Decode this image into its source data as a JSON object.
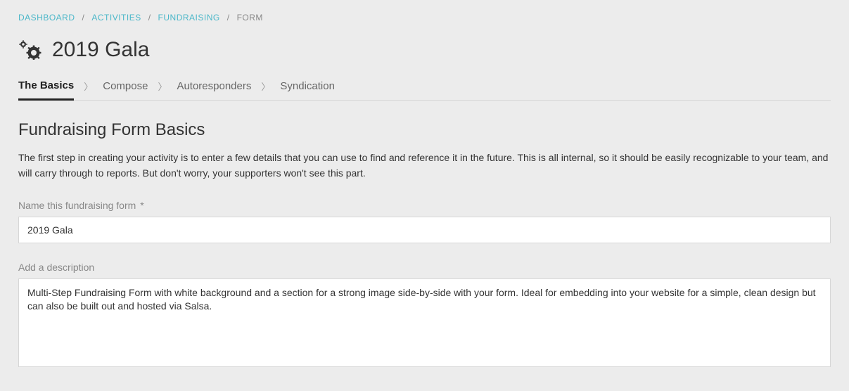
{
  "breadcrumb": {
    "items": [
      {
        "label": "DASHBOARD",
        "link": true
      },
      {
        "label": "ACTIVITIES",
        "link": true
      },
      {
        "label": "FUNDRAISING",
        "link": true
      },
      {
        "label": "FORM",
        "link": false
      }
    ]
  },
  "page_title": "2019 Gala",
  "tabs": {
    "items": [
      {
        "label": "The Basics",
        "active": true
      },
      {
        "label": "Compose",
        "active": false
      },
      {
        "label": "Autoresponders",
        "active": false
      },
      {
        "label": "Syndication",
        "active": false
      }
    ]
  },
  "section": {
    "heading": "Fundraising Form Basics",
    "description": "The first step in creating your activity is to enter a few details that you can use to find and reference it in the future. This is all internal, so it should be easily recognizable to your team, and will carry through to reports. But don't worry, your supporters won't see this part."
  },
  "form": {
    "name_label": "Name this fundraising form",
    "name_required_marker": "*",
    "name_value": "2019 Gala",
    "desc_label": "Add a description",
    "desc_value": "Multi-Step Fundraising Form with white background and a section for a strong image side-by-side with your form. Ideal for embedding into your website for a simple, clean design but can also be built out and hosted via Salsa."
  }
}
